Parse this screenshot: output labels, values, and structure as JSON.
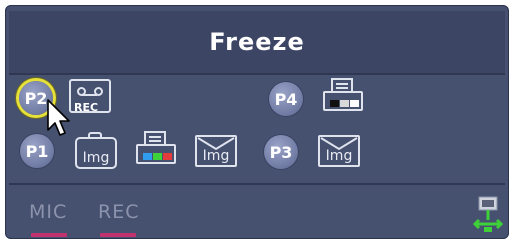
{
  "title": "Freeze",
  "presets": {
    "p1": "P1",
    "p2": "P2",
    "p3": "P3",
    "p4": "P4"
  },
  "icons": {
    "rec_label": "REC",
    "img_label": "Img"
  },
  "bottom": {
    "mic_label": "MIC",
    "rec_label": "REC"
  },
  "colors": {
    "panel": "#46506f",
    "title_bar": "#3c4564",
    "button": "#7580a8",
    "active_ring": "#e5e03a",
    "underline": "#c0336f",
    "network": "#3fd13a"
  }
}
